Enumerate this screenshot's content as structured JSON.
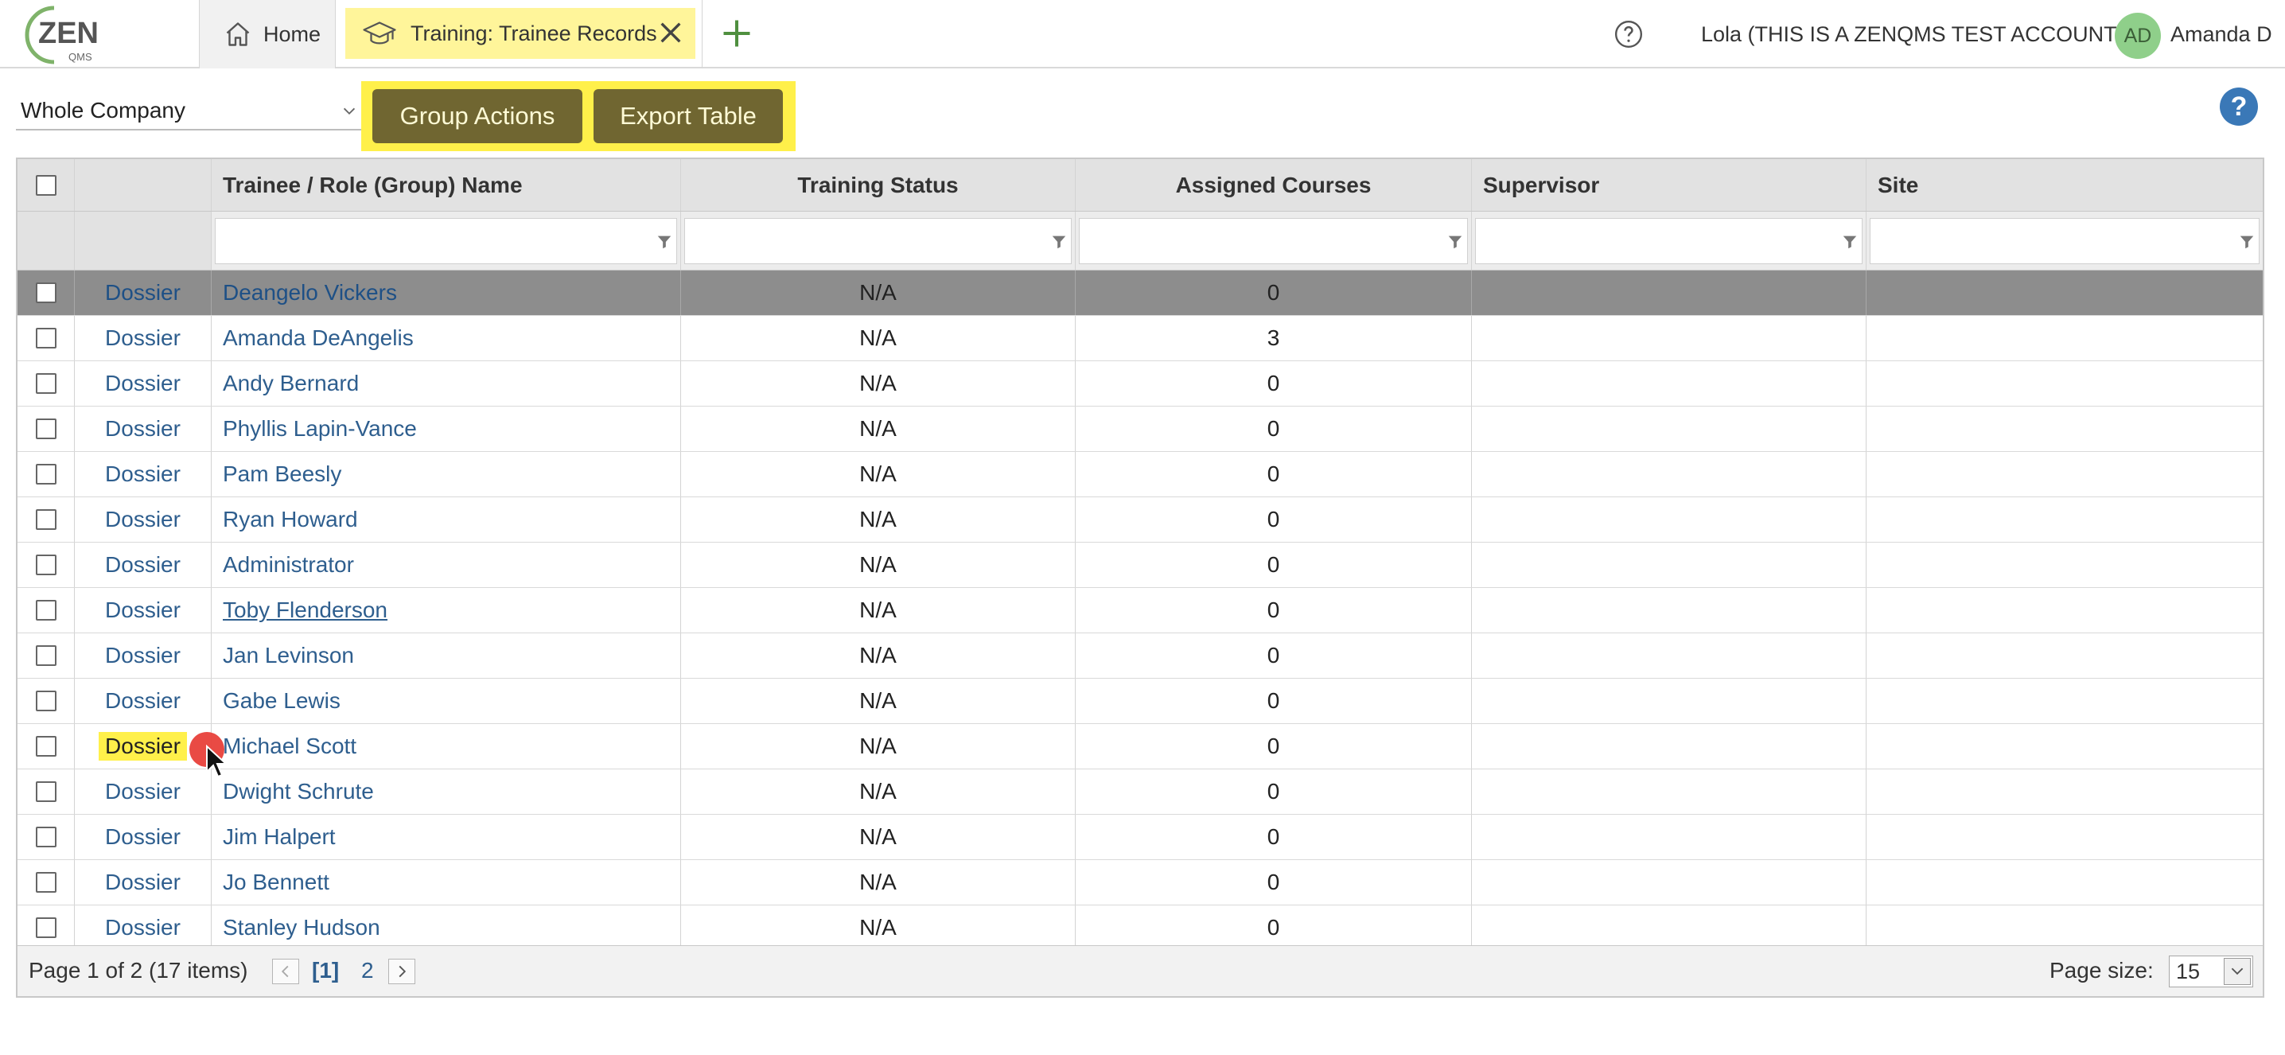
{
  "topbar": {
    "logo_text": "ZEN",
    "logo_sub": "QMS",
    "home_tab": "Home",
    "active_tab": "Training: Trainee Records",
    "account_label": "Lola (THIS IS A ZENQMS TEST ACCOUNT)",
    "avatar_initials": "AD",
    "user_name": "Amanda D"
  },
  "toolbar": {
    "scope_value": "Whole Company",
    "group_actions_label": "Group Actions",
    "export_table_label": "Export Table",
    "help_label": "?"
  },
  "grid": {
    "columns": [
      "Trainee / Role (Group) Name",
      "Training Status",
      "Assigned Courses",
      "Supervisor",
      "Site"
    ],
    "rows": [
      {
        "link": "Dossier",
        "name": "Deangelo Vickers",
        "status": "N/A",
        "courses": "0",
        "supervisor": "",
        "site": ""
      },
      {
        "link": "Dossier",
        "name": "Amanda DeAngelis",
        "status": "N/A",
        "courses": "3",
        "supervisor": "",
        "site": ""
      },
      {
        "link": "Dossier",
        "name": "Andy Bernard",
        "status": "N/A",
        "courses": "0",
        "supervisor": "",
        "site": ""
      },
      {
        "link": "Dossier",
        "name": "Phyllis Lapin-Vance",
        "status": "N/A",
        "courses": "0",
        "supervisor": "",
        "site": ""
      },
      {
        "link": "Dossier",
        "name": "Pam Beesly",
        "status": "N/A",
        "courses": "0",
        "supervisor": "",
        "site": ""
      },
      {
        "link": "Dossier",
        "name": "Ryan Howard",
        "status": "N/A",
        "courses": "0",
        "supervisor": "",
        "site": ""
      },
      {
        "link": "Dossier",
        "name": "Administrator",
        "status": "N/A",
        "courses": "0",
        "supervisor": "",
        "site": ""
      },
      {
        "link": "Dossier",
        "name": "Toby Flenderson",
        "status": "N/A",
        "courses": "0",
        "supervisor": "",
        "site": ""
      },
      {
        "link": "Dossier",
        "name": "Jan Levinson",
        "status": "N/A",
        "courses": "0",
        "supervisor": "",
        "site": ""
      },
      {
        "link": "Dossier",
        "name": "Gabe Lewis",
        "status": "N/A",
        "courses": "0",
        "supervisor": "",
        "site": ""
      },
      {
        "link": "Dossier",
        "name": "Michael Scott",
        "status": "N/A",
        "courses": "0",
        "supervisor": "",
        "site": ""
      },
      {
        "link": "Dossier",
        "name": "Dwight Schrute",
        "status": "N/A",
        "courses": "0",
        "supervisor": "",
        "site": ""
      },
      {
        "link": "Dossier",
        "name": "Jim Halpert",
        "status": "N/A",
        "courses": "0",
        "supervisor": "",
        "site": ""
      },
      {
        "link": "Dossier",
        "name": "Jo Bennett",
        "status": "N/A",
        "courses": "0",
        "supervisor": "",
        "site": ""
      },
      {
        "link": "Dossier",
        "name": "Stanley Hudson",
        "status": "N/A",
        "courses": "0",
        "supervisor": "",
        "site": ""
      }
    ]
  },
  "pager": {
    "info": "Page 1 of 2 (17 items)",
    "current_page": "[1]",
    "next_page": "2",
    "page_size_label": "Page size:",
    "page_size_value": "15"
  },
  "colors": {
    "highlight": "#fff04a",
    "button_bg": "#706631",
    "link": "#2e5e8e",
    "selected_row": "#8d8d8d",
    "help_blue": "#3a78b7"
  },
  "icons": [
    "home-icon",
    "graduation-cap-icon",
    "close-icon",
    "plus-icon",
    "help-circle-icon",
    "chevron-down-icon",
    "filter-icon",
    "chevron-left-icon",
    "chevron-right-icon"
  ]
}
